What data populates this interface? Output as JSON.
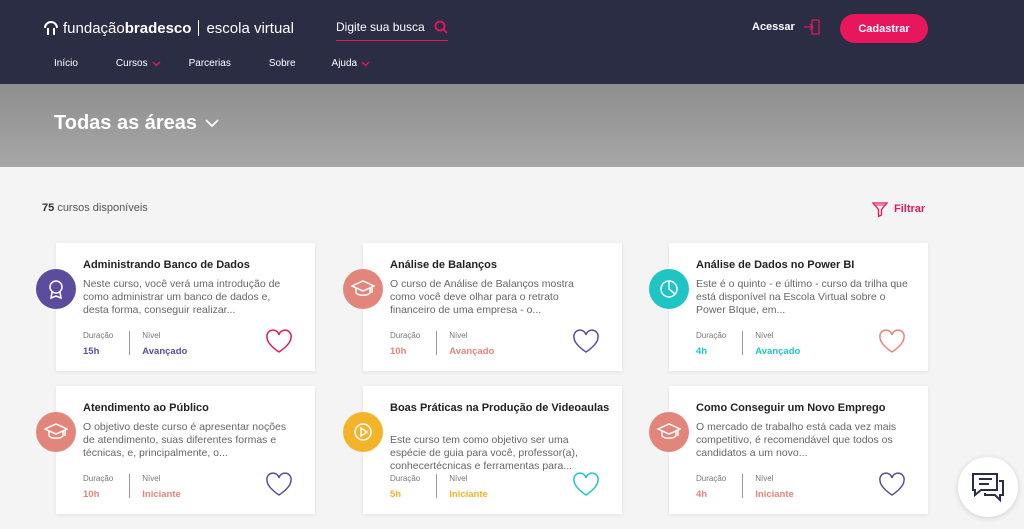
{
  "header": {
    "logo_part1": "fundação",
    "logo_part2": "bradesco",
    "logo_part3": "escola virtual",
    "search_placeholder": "Digite sua busca",
    "login_label": "Acessar",
    "signup_label": "Cadastrar",
    "nav": [
      {
        "label": "Início",
        "has_dropdown": false
      },
      {
        "label": "Cursos",
        "has_dropdown": true
      },
      {
        "label": "Parcerias",
        "has_dropdown": false
      },
      {
        "label": "Sobre",
        "has_dropdown": false
      },
      {
        "label": "Ajuda",
        "has_dropdown": true
      }
    ]
  },
  "hero": {
    "title": "Todas as áreas"
  },
  "listing": {
    "count": "75",
    "count_suffix": "cursos disponíveis",
    "filter_label": "Filtrar"
  },
  "colors": {
    "accent": "#e8175d",
    "header_bg": "#2b2d45",
    "purple": "#5c4c9e",
    "salmon": "#e2857b",
    "teal": "#1fc5c5",
    "amber": "#f3b32a"
  },
  "courses": [
    {
      "title": "Administrando Banco de Dados",
      "desc": "Neste curso, você verá uma introdução de como administrar um banco de dados e, desta forma, conseguir realizar...",
      "duration_label": "Duração",
      "duration": "15h",
      "level_label": "Nível",
      "level": "Avançado",
      "icon": "award-icon",
      "color": "#5c4c9e"
    },
    {
      "title": "Análise de Balanços",
      "desc": "O curso de Análise de Balanços mostra como você deve olhar para o retrato financeiro de uma empresa - o...",
      "duration_label": "Duração",
      "duration": "10h",
      "level_label": "Nível",
      "level": "Avançado",
      "icon": "graduation-cap-icon",
      "color": "#e2857b"
    },
    {
      "title": "Análise de Dados no Power BI",
      "desc": "Este é o quinto - e último - curso da trilha que está disponível na Escola Virtual sobre o Power BIque, em...",
      "duration_label": "Duração",
      "duration": "4h",
      "level_label": "Nível",
      "level": "Avançado",
      "icon": "pie-chart-icon",
      "color": "#1fc5c5"
    },
    {
      "title": "Atendimento ao Público",
      "desc": "O objetivo deste curso é apresentar noções de atendimento, suas diferentes formas e técnicas, e, principalmente, o...",
      "duration_label": "Duração",
      "duration": "10h",
      "level_label": "Nível",
      "level": "Iniciante",
      "icon": "graduation-cap-icon",
      "color": "#e2857b"
    },
    {
      "title": "Boas Práticas na Produção de Videoaulas",
      "desc": "Este curso tem como objetivo ser uma espécie de guia para você, professor(a), conhecertécnicas e ferramentas para...",
      "duration_label": "Duração",
      "duration": "5h",
      "level_label": "Nível",
      "level": "Iniciante",
      "icon": "play-icon",
      "color": "#f3b32a"
    },
    {
      "title": "Como Conseguir um Novo Emprego",
      "desc": "O mercado de trabalho está cada vez mais competitivo, é recomendável que todos os candidatos a um novo...",
      "duration_label": "Duração",
      "duration": "4h",
      "level_label": "Nível",
      "level": "Iniciante",
      "icon": "graduation-cap-icon",
      "color": "#e2857b"
    }
  ]
}
